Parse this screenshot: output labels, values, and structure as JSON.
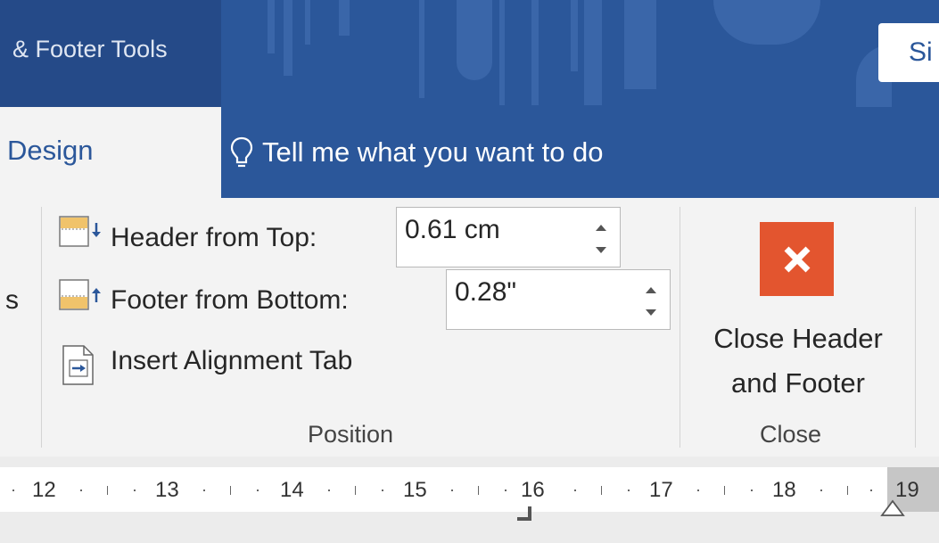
{
  "title_bar": {
    "context_tools_label": "& Footer Tools",
    "sign_in_label": "Si"
  },
  "tabs": {
    "active_tab": "Design",
    "tell_me": "Tell me what you want to do"
  },
  "ribbon": {
    "left_cut_text": "s",
    "position_group": {
      "header_from_top_label": "Header from Top:",
      "header_from_top_value": "0.61 cm",
      "footer_from_bottom_label": "Footer from Bottom:",
      "footer_from_bottom_value": "0.28\"",
      "insert_alignment_tab_label": "Insert Alignment Tab",
      "group_label": "Position"
    },
    "close_group": {
      "close_button_line1": "Close Header",
      "close_button_line2": "and Footer",
      "group_label": "Close"
    }
  },
  "ruler": {
    "numbers": [
      "12",
      "13",
      "14",
      "15",
      "16",
      "17",
      "18",
      "19"
    ]
  },
  "colors": {
    "title_blue": "#2b579a",
    "context_blue": "#254a88",
    "close_red": "#e3552f",
    "ribbon_bg": "#f3f3f3"
  }
}
